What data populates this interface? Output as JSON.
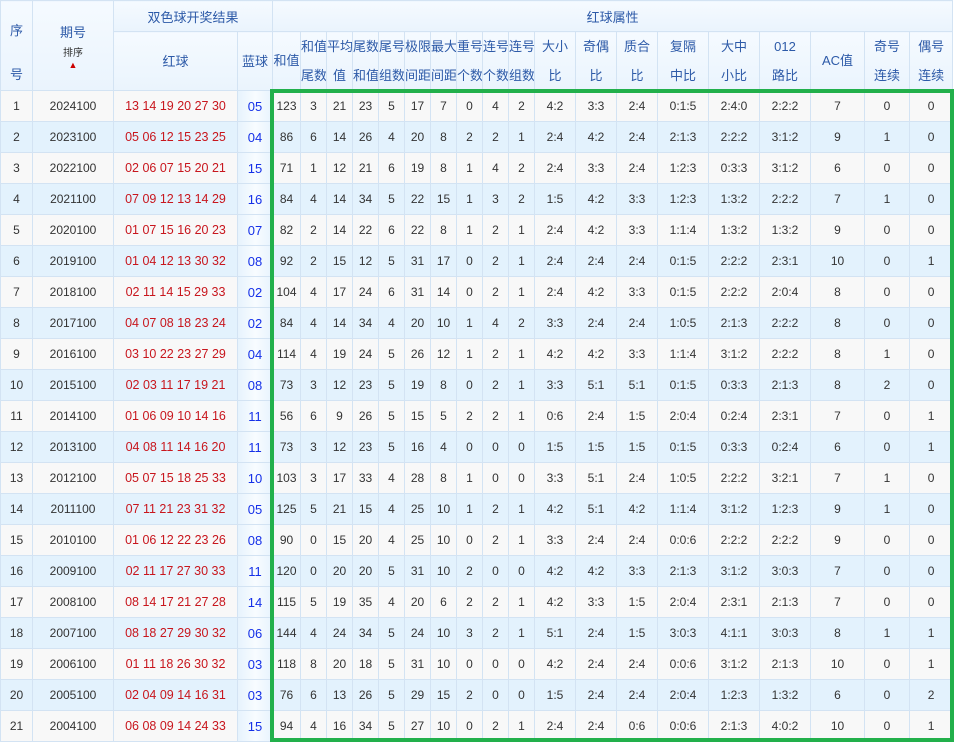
{
  "header": {
    "seq": [
      "序",
      "号"
    ],
    "issue": "期号",
    "sort": "排序",
    "sort_icon": "up-arrow-icon",
    "result_group": "双色球开奖结果",
    "red": "红球",
    "blue": "蓝球",
    "attr_group": "红球属性",
    "attr_cols": [
      [
        "和值"
      ],
      [
        "和值",
        "尾数"
      ],
      [
        "平均",
        "值"
      ],
      [
        "尾数",
        "和值"
      ],
      [
        "尾号",
        "组数"
      ],
      [
        "极限",
        "间距"
      ],
      [
        "最大",
        "间距"
      ],
      [
        "重号",
        "个数"
      ],
      [
        "连号",
        "个数"
      ],
      [
        "连号",
        "组数"
      ],
      [
        "大小",
        "比"
      ],
      [
        "奇偶",
        "比"
      ],
      [
        "质合",
        "比"
      ],
      [
        "复隔",
        "中比"
      ],
      [
        "大中",
        "小比"
      ],
      [
        "012",
        "路比"
      ],
      [
        "AC值"
      ],
      [
        "奇号",
        "连续"
      ],
      [
        "偶号",
        "连续"
      ]
    ]
  },
  "colors": {
    "highlight_border": "#22b04b",
    "red_ball": "#c8161d",
    "blue_ball": "#1530e8"
  },
  "rows": [
    {
      "seq": "1",
      "issue": "2024100",
      "red": "13 14 19 20 27 30",
      "blue": "05",
      "attrs": [
        "123",
        "3",
        "21",
        "23",
        "5",
        "17",
        "7",
        "0",
        "4",
        "2",
        "4:2",
        "3:3",
        "2:4",
        "0:1:5",
        "2:4:0",
        "2:2:2",
        "7",
        "0",
        "0"
      ]
    },
    {
      "seq": "2",
      "issue": "2023100",
      "red": "05 06 12 15 23 25",
      "blue": "04",
      "attrs": [
        "86",
        "6",
        "14",
        "26",
        "4",
        "20",
        "8",
        "2",
        "2",
        "1",
        "2:4",
        "4:2",
        "2:4",
        "2:1:3",
        "2:2:2",
        "3:1:2",
        "9",
        "1",
        "0"
      ]
    },
    {
      "seq": "3",
      "issue": "2022100",
      "red": "02 06 07 15 20 21",
      "blue": "15",
      "attrs": [
        "71",
        "1",
        "12",
        "21",
        "6",
        "19",
        "8",
        "1",
        "4",
        "2",
        "2:4",
        "3:3",
        "2:4",
        "1:2:3",
        "0:3:3",
        "3:1:2",
        "6",
        "0",
        "0"
      ]
    },
    {
      "seq": "4",
      "issue": "2021100",
      "red": "07 09 12 13 14 29",
      "blue": "16",
      "attrs": [
        "84",
        "4",
        "14",
        "34",
        "5",
        "22",
        "15",
        "1",
        "3",
        "2",
        "1:5",
        "4:2",
        "3:3",
        "1:2:3",
        "1:3:2",
        "2:2:2",
        "7",
        "1",
        "0"
      ]
    },
    {
      "seq": "5",
      "issue": "2020100",
      "red": "01 07 15 16 20 23",
      "blue": "07",
      "attrs": [
        "82",
        "2",
        "14",
        "22",
        "6",
        "22",
        "8",
        "1",
        "2",
        "1",
        "2:4",
        "4:2",
        "3:3",
        "1:1:4",
        "1:3:2",
        "1:3:2",
        "9",
        "0",
        "0"
      ]
    },
    {
      "seq": "6",
      "issue": "2019100",
      "red": "01 04 12 13 30 32",
      "blue": "08",
      "attrs": [
        "92",
        "2",
        "15",
        "12",
        "5",
        "31",
        "17",
        "0",
        "2",
        "1",
        "2:4",
        "2:4",
        "2:4",
        "0:1:5",
        "2:2:2",
        "2:3:1",
        "10",
        "0",
        "1"
      ]
    },
    {
      "seq": "7",
      "issue": "2018100",
      "red": "02 11 14 15 29 33",
      "blue": "02",
      "attrs": [
        "104",
        "4",
        "17",
        "24",
        "6",
        "31",
        "14",
        "0",
        "2",
        "1",
        "2:4",
        "4:2",
        "3:3",
        "0:1:5",
        "2:2:2",
        "2:0:4",
        "8",
        "0",
        "0"
      ]
    },
    {
      "seq": "8",
      "issue": "2017100",
      "red": "04 07 08 18 23 24",
      "blue": "02",
      "attrs": [
        "84",
        "4",
        "14",
        "34",
        "4",
        "20",
        "10",
        "1",
        "4",
        "2",
        "3:3",
        "2:4",
        "2:4",
        "1:0:5",
        "2:1:3",
        "2:2:2",
        "8",
        "0",
        "0"
      ]
    },
    {
      "seq": "9",
      "issue": "2016100",
      "red": "03 10 22 23 27 29",
      "blue": "04",
      "attrs": [
        "114",
        "4",
        "19",
        "24",
        "5",
        "26",
        "12",
        "1",
        "2",
        "1",
        "4:2",
        "4:2",
        "3:3",
        "1:1:4",
        "3:1:2",
        "2:2:2",
        "8",
        "1",
        "0"
      ]
    },
    {
      "seq": "10",
      "issue": "2015100",
      "red": "02 03 11 17 19 21",
      "blue": "08",
      "attrs": [
        "73",
        "3",
        "12",
        "23",
        "5",
        "19",
        "8",
        "0",
        "2",
        "1",
        "3:3",
        "5:1",
        "5:1",
        "0:1:5",
        "0:3:3",
        "2:1:3",
        "8",
        "2",
        "0"
      ]
    },
    {
      "seq": "11",
      "issue": "2014100",
      "red": "01 06 09 10 14 16",
      "blue": "11",
      "attrs": [
        "56",
        "6",
        "9",
        "26",
        "5",
        "15",
        "5",
        "2",
        "2",
        "1",
        "0:6",
        "2:4",
        "1:5",
        "2:0:4",
        "0:2:4",
        "2:3:1",
        "7",
        "0",
        "1"
      ]
    },
    {
      "seq": "12",
      "issue": "2013100",
      "red": "04 08 11 14 16 20",
      "blue": "11",
      "attrs": [
        "73",
        "3",
        "12",
        "23",
        "5",
        "16",
        "4",
        "0",
        "0",
        "0",
        "1:5",
        "1:5",
        "1:5",
        "0:1:5",
        "0:3:3",
        "0:2:4",
        "6",
        "0",
        "1"
      ]
    },
    {
      "seq": "13",
      "issue": "2012100",
      "red": "05 07 15 18 25 33",
      "blue": "10",
      "attrs": [
        "103",
        "3",
        "17",
        "33",
        "4",
        "28",
        "8",
        "1",
        "0",
        "0",
        "3:3",
        "5:1",
        "2:4",
        "1:0:5",
        "2:2:2",
        "3:2:1",
        "7",
        "1",
        "0"
      ]
    },
    {
      "seq": "14",
      "issue": "2011100",
      "red": "07 11 21 23 31 32",
      "blue": "05",
      "attrs": [
        "125",
        "5",
        "21",
        "15",
        "4",
        "25",
        "10",
        "1",
        "2",
        "1",
        "4:2",
        "5:1",
        "4:2",
        "1:1:4",
        "3:1:2",
        "1:2:3",
        "9",
        "1",
        "0"
      ]
    },
    {
      "seq": "15",
      "issue": "2010100",
      "red": "01 06 12 22 23 26",
      "blue": "08",
      "attrs": [
        "90",
        "0",
        "15",
        "20",
        "4",
        "25",
        "10",
        "0",
        "2",
        "1",
        "3:3",
        "2:4",
        "2:4",
        "0:0:6",
        "2:2:2",
        "2:2:2",
        "9",
        "0",
        "0"
      ]
    },
    {
      "seq": "16",
      "issue": "2009100",
      "red": "02 11 17 27 30 33",
      "blue": "11",
      "attrs": [
        "120",
        "0",
        "20",
        "20",
        "5",
        "31",
        "10",
        "2",
        "0",
        "0",
        "4:2",
        "4:2",
        "3:3",
        "2:1:3",
        "3:1:2",
        "3:0:3",
        "7",
        "0",
        "0"
      ]
    },
    {
      "seq": "17",
      "issue": "2008100",
      "red": "08 14 17 21 27 28",
      "blue": "14",
      "attrs": [
        "115",
        "5",
        "19",
        "35",
        "4",
        "20",
        "6",
        "2",
        "2",
        "1",
        "4:2",
        "3:3",
        "1:5",
        "2:0:4",
        "2:3:1",
        "2:1:3",
        "7",
        "0",
        "0"
      ]
    },
    {
      "seq": "18",
      "issue": "2007100",
      "red": "08 18 27 29 30 32",
      "blue": "06",
      "attrs": [
        "144",
        "4",
        "24",
        "34",
        "5",
        "24",
        "10",
        "3",
        "2",
        "1",
        "5:1",
        "2:4",
        "1:5",
        "3:0:3",
        "4:1:1",
        "3:0:3",
        "8",
        "1",
        "1"
      ]
    },
    {
      "seq": "19",
      "issue": "2006100",
      "red": "01 11 18 26 30 32",
      "blue": "03",
      "attrs": [
        "118",
        "8",
        "20",
        "18",
        "5",
        "31",
        "10",
        "0",
        "0",
        "0",
        "4:2",
        "2:4",
        "2:4",
        "0:0:6",
        "3:1:2",
        "2:1:3",
        "10",
        "0",
        "1"
      ]
    },
    {
      "seq": "20",
      "issue": "2005100",
      "red": "02 04 09 14 16 31",
      "blue": "03",
      "attrs": [
        "76",
        "6",
        "13",
        "26",
        "5",
        "29",
        "15",
        "2",
        "0",
        "0",
        "1:5",
        "2:4",
        "2:4",
        "2:0:4",
        "1:2:3",
        "1:3:2",
        "6",
        "0",
        "2"
      ]
    },
    {
      "seq": "21",
      "issue": "2004100",
      "red": "06 08 09 14 24 33",
      "blue": "15",
      "attrs": [
        "94",
        "4",
        "16",
        "34",
        "5",
        "27",
        "10",
        "0",
        "2",
        "1",
        "2:4",
        "2:4",
        "0:6",
        "0:0:6",
        "2:1:3",
        "4:0:2",
        "10",
        "0",
        "1"
      ]
    }
  ]
}
